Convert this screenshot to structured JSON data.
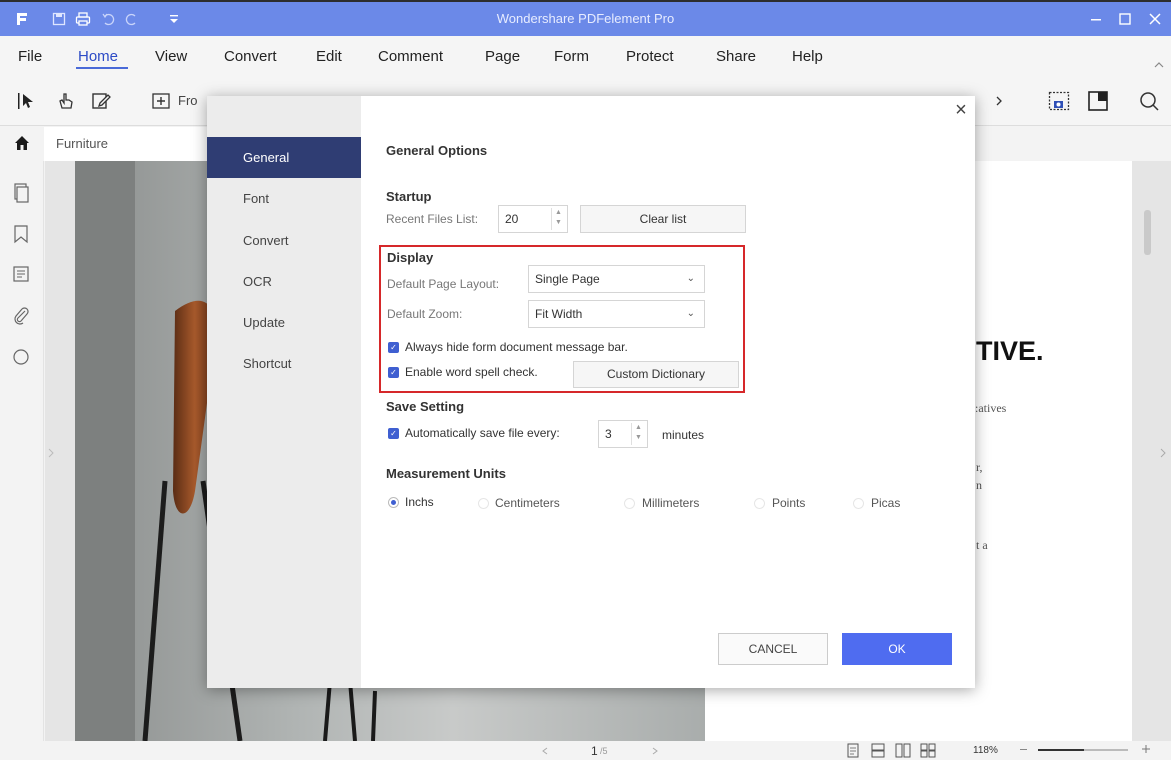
{
  "app": {
    "title": "Wondershare PDFelement Pro"
  },
  "colors": {
    "titlebar": "#6b89e8",
    "accent": "#4f6cf0",
    "nav_active": "#2f3d73",
    "highlight": "#d6282a"
  },
  "menu": {
    "items": [
      "File",
      "Home",
      "View",
      "Convert",
      "Edit",
      "Comment",
      "Page",
      "Form",
      "Protect",
      "Share",
      "Help"
    ],
    "active": "Home"
  },
  "toolbar": {
    "from_label": "Fro"
  },
  "tab": {
    "label": "Furniture"
  },
  "document": {
    "heading": "TIVE.",
    "lines": [
      ":atives",
      "r,",
      "n",
      "t a"
    ]
  },
  "status": {
    "page": "1",
    "page_total": "/5",
    "zoom": "118%"
  },
  "dialog": {
    "nav": [
      "General",
      "Font",
      "Convert",
      "OCR",
      "Update",
      "Shortcut"
    ],
    "active_nav": "General",
    "title": "General Options",
    "startup": {
      "heading": "Startup",
      "recent_label": "Recent Files List:",
      "recent_value": "20",
      "clear_label": "Clear list"
    },
    "display": {
      "heading": "Display",
      "layout_label": "Default Page Layout:",
      "layout_value": "Single Page",
      "zoom_label": "Default Zoom:",
      "zoom_value": "Fit Width",
      "hide_bar_label": "Always hide form document message bar.",
      "spell_label": "Enable word spell check.",
      "dictionary_label": "Custom Dictionary"
    },
    "save": {
      "heading": "Save Setting",
      "autosave_label": "Automatically save file every:",
      "autosave_value": "3",
      "unit": "minutes"
    },
    "units": {
      "heading": "Measurement Units",
      "options": [
        "Inchs",
        "Centimeters",
        "Millimeters",
        "Points",
        "Picas"
      ],
      "selected": "Inchs"
    },
    "cancel_label": "CANCEL",
    "ok_label": "OK"
  }
}
